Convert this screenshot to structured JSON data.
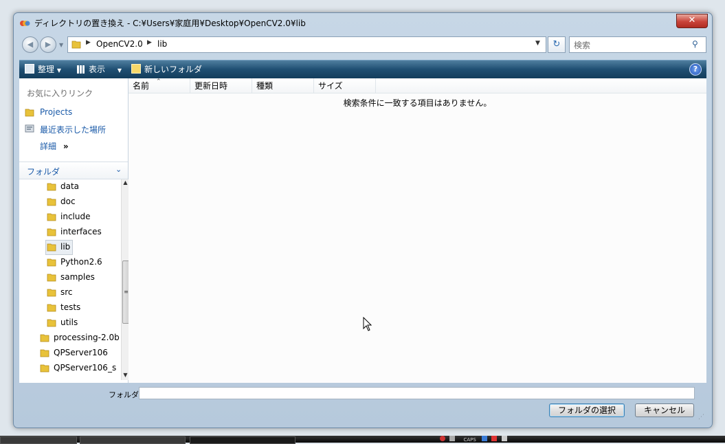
{
  "window": {
    "title": "ディレクトリの置き換え - C:¥Users¥家庭用¥Desktop¥OpenCV2.0¥lib",
    "close_label": "✕"
  },
  "navigation": {
    "back_icon": "back-arrow-icon",
    "forward_icon": "forward-arrow-icon",
    "path": [
      "OpenCV2.0",
      "lib"
    ],
    "search_placeholder": "検索"
  },
  "toolbar": {
    "organize_label": "整理",
    "view_label": "表示",
    "new_folder_label": "新しいフォルダ"
  },
  "favorites": {
    "header": "お気に入りリンク",
    "items": [
      {
        "label": "Projects",
        "icon": "folder-icon"
      },
      {
        "label": "最近表示した場所",
        "icon": "recent-places-icon"
      },
      {
        "label": "詳細",
        "icon": "chevron-double-right-icon",
        "suffix": "»"
      }
    ]
  },
  "folders": {
    "header": "フォルダ",
    "items": [
      {
        "label": "data"
      },
      {
        "label": "doc"
      },
      {
        "label": "include"
      },
      {
        "label": "interfaces"
      },
      {
        "label": "lib",
        "selected": true
      },
      {
        "label": "Python2.6"
      },
      {
        "label": "samples"
      },
      {
        "label": "src"
      },
      {
        "label": "tests"
      },
      {
        "label": "utils"
      },
      {
        "label": "processing-2.0b"
      },
      {
        "label": "QPServer106"
      },
      {
        "label": "QPServer106_s"
      }
    ]
  },
  "file_list": {
    "columns": [
      "名前",
      "更新日時",
      "種類",
      "サイズ"
    ],
    "empty_message": "検索条件に一致する項目はありません。"
  },
  "footer": {
    "folder_label": "フォルダ:",
    "folder_value": "",
    "select_button": "フォルダの選択",
    "cancel_button": "キャンセル"
  },
  "tray": {
    "caps_label": "CAPS"
  },
  "colors": {
    "link_blue": "#1a5aa8",
    "toolbar_dark": "#1f4f72",
    "close_red": "#c9443a",
    "folder_yellow": "#e8c23a"
  }
}
